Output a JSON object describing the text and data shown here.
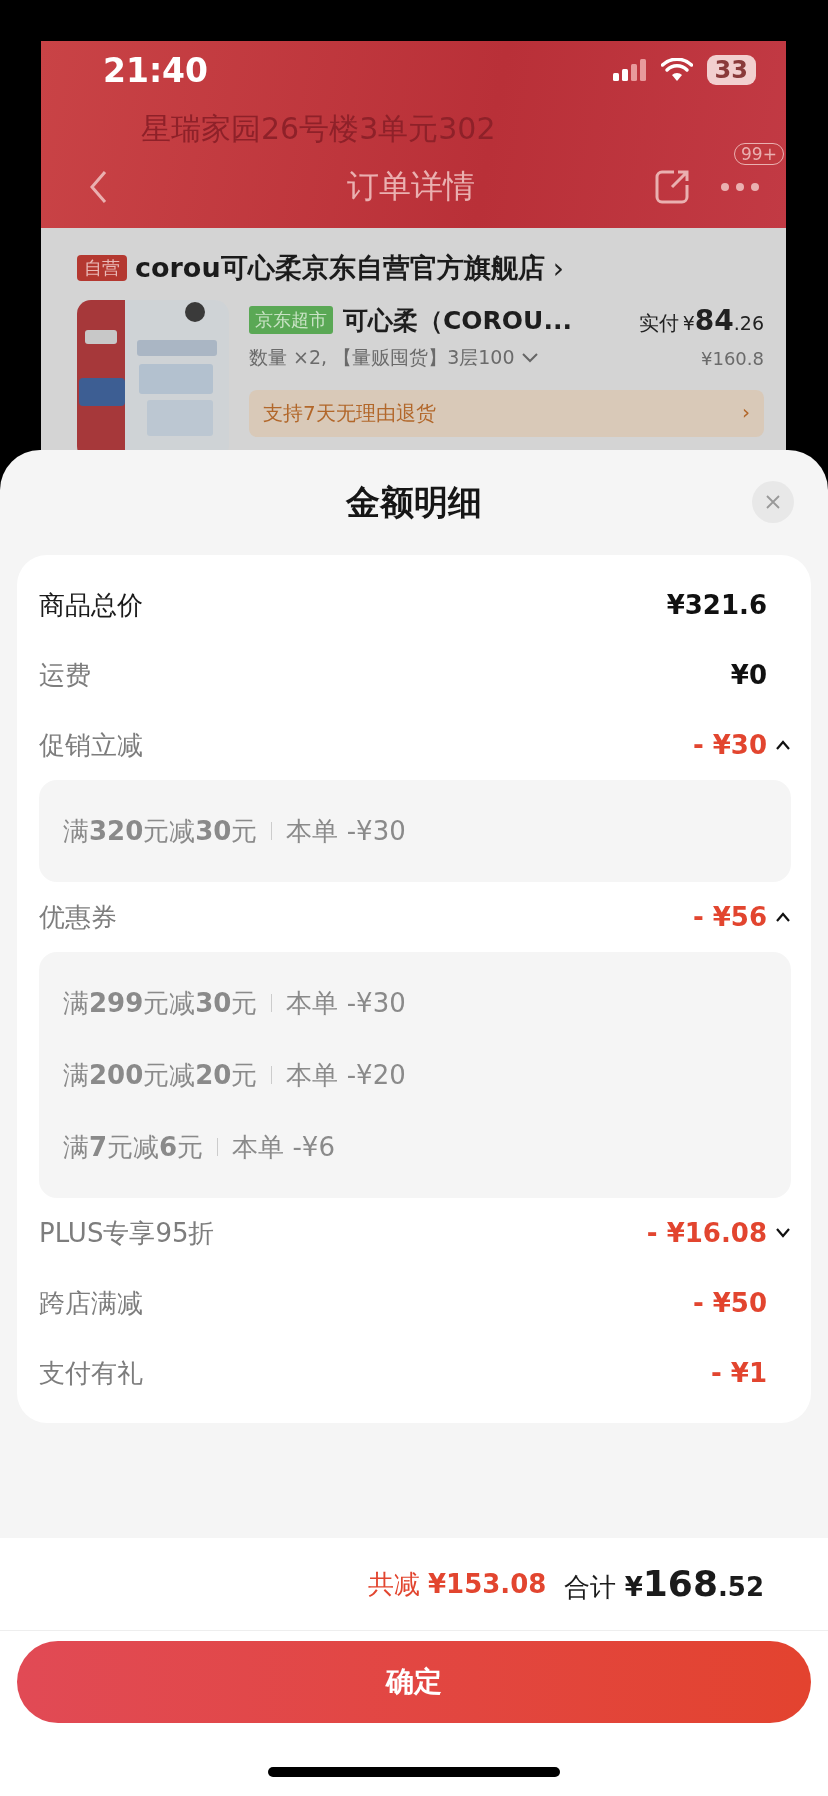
{
  "status_bar": {
    "time": "21:40",
    "battery": "33"
  },
  "background_page": {
    "address": "星瑞家园26号楼3单元302",
    "title": "订单详情",
    "badge": "99+",
    "store": {
      "tag": "自营",
      "name": "corou可心柔京东自营官方旗舰店",
      "chevron": "›"
    },
    "product": {
      "tag": "京东超市",
      "name": "可心柔（COROU...",
      "paid_label": "实付",
      "paid_currency": "¥",
      "paid_integer": "84",
      "paid_decimal": ".26",
      "spec": "数量 ×2, 【量贩囤货】3层100",
      "original_price": "¥160.8",
      "service": "支持7天无理由退货",
      "service_chevron": "›"
    }
  },
  "sheet": {
    "title": "金额明细",
    "rows": [
      {
        "kind": "total",
        "label": "商品总价",
        "value": "¥321.6"
      },
      {
        "kind": "fee",
        "label": "运费",
        "value": "¥0"
      },
      {
        "kind": "discount",
        "label": "促销立减",
        "value": "- ¥30",
        "expanded": true,
        "details": [
          {
            "rule": "满**320**元减**30**元",
            "amount": "本单 -¥30"
          }
        ]
      },
      {
        "kind": "discount",
        "label": "优惠券",
        "value": "- ¥56",
        "expanded": true,
        "details": [
          {
            "rule": "满**299**元减**30**元",
            "amount": "本单 -¥30"
          },
          {
            "rule": "满**200**元减**20**元",
            "amount": "本单 -¥20"
          },
          {
            "rule": "满**7**元减**6**元",
            "amount": "本单 -¥6"
          }
        ]
      },
      {
        "kind": "discount",
        "label": "PLUS专享95折",
        "value": "- ¥16.08",
        "expanded": false
      },
      {
        "kind": "discount",
        "label": "跨店满减",
        "value": "- ¥50"
      },
      {
        "kind": "discount",
        "label": "支付有礼",
        "value": "- ¥1"
      }
    ],
    "saved_label": "共减",
    "saved_value": "¥153.08",
    "total_label": "合计",
    "total_currency": "¥",
    "total_integer": "168",
    "total_decimal": ".52",
    "confirm_button": "确定"
  }
}
